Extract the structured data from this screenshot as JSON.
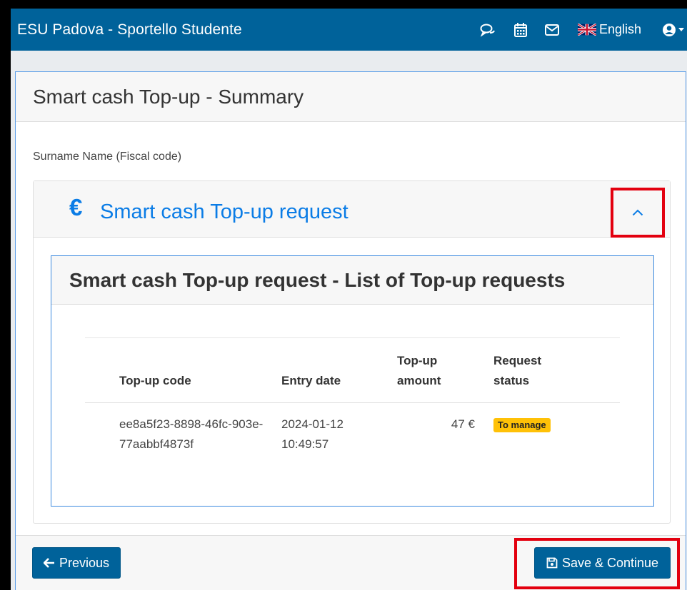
{
  "navbar": {
    "brand": "ESU Padova - Sportello Studente",
    "language": "English",
    "icons": [
      "chat-icon",
      "calendar-icon",
      "mail-icon",
      "uk-flag-icon",
      "user-icon"
    ]
  },
  "page": {
    "title": "Smart cash Top-up - Summary",
    "subject": "Surname Name (Fiscal code)"
  },
  "accordion": {
    "symbol": "€",
    "title": "Smart cash Top-up request"
  },
  "list": {
    "title": "Smart cash Top-up request - List of Top-up requests",
    "columns": {
      "code": "Top-up code",
      "date": "Entry date",
      "amount_line1": "Top-up",
      "amount_line2": "amount",
      "status_line1": "Request",
      "status_line2": "status"
    },
    "rows": [
      {
        "code_line1": "ee8a5f23-8898-46fc-903e-",
        "code_line2": "77aabbf4873f",
        "date_line1": "2024-01-12",
        "date_line2": "10:49:57",
        "amount": "47 €",
        "status": "To manage"
      }
    ]
  },
  "footer": {
    "previous_label": "Previous",
    "save_label": "Save & Continue"
  },
  "colors": {
    "navbar": "#00629a",
    "accent": "#0a7ce6",
    "highlight": "#e3000f",
    "badge": "#ffc107"
  }
}
